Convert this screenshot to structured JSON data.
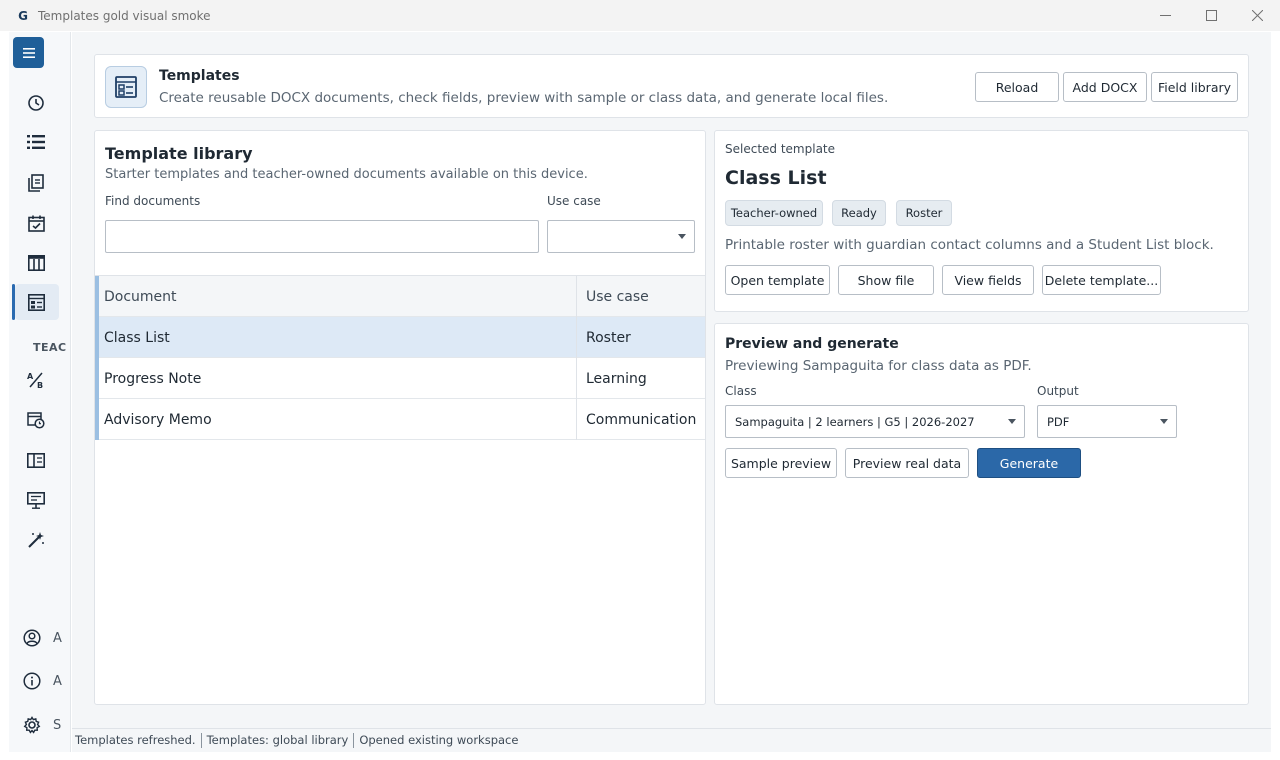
{
  "window": {
    "logo_glyph": "G",
    "title": "Templates gold visual smoke"
  },
  "sidebar": {
    "section_label": "TEAC",
    "nav_icons": [
      "history-icon",
      "list-icon",
      "documents-icon",
      "calendar-check-icon",
      "table-columns-icon",
      "templates-icon",
      "grading-icon",
      "schedule-icon",
      "book-icon",
      "presentation-icon",
      "magic-wand-icon"
    ],
    "active_item": "templates-icon",
    "bottom_items": [
      {
        "icon": "account-icon",
        "label": "A"
      },
      {
        "icon": "info-icon",
        "label": "A"
      },
      {
        "icon": "settings-icon",
        "label": "S"
      }
    ]
  },
  "header": {
    "title": "Templates",
    "subtitle": "Create reusable DOCX documents, check fields, preview with sample or class data, and generate local files.",
    "buttons": {
      "reload": "Reload",
      "add_docx": "Add DOCX",
      "field_library": "Field library"
    }
  },
  "library": {
    "title": "Template library",
    "subtitle": "Starter templates and teacher-owned documents available on this device.",
    "search_label": "Find documents",
    "search_value": "",
    "use_case_label": "Use case",
    "use_case_value": "",
    "columns": [
      "Document",
      "Use case"
    ],
    "rows": [
      {
        "document": "Class List",
        "use_case": "Roster",
        "selected": true
      },
      {
        "document": "Progress Note",
        "use_case": "Learning",
        "selected": false
      },
      {
        "document": "Advisory Memo",
        "use_case": "Communication",
        "selected": false
      }
    ]
  },
  "selected": {
    "label": "Selected template",
    "title": "Class List",
    "chips": [
      "Teacher-owned",
      "Ready",
      "Roster"
    ],
    "description": "Printable roster with guardian contact columns and a Student List block.",
    "buttons": {
      "open": "Open template",
      "show_file": "Show file",
      "view_fields": "View fields",
      "delete": "Delete template..."
    }
  },
  "generate": {
    "title": "Preview and generate",
    "subtitle": "Previewing Sampaguita for class data as PDF.",
    "class_label": "Class",
    "class_value": "Sampaguita | 2 learners | G5 | 2026-2027",
    "output_label": "Output",
    "output_value": "PDF",
    "buttons": {
      "sample": "Sample preview",
      "real": "Preview real data",
      "generate": "Generate"
    }
  },
  "status": [
    "Templates refreshed.",
    "Templates: global library",
    "Opened existing workspace"
  ],
  "colors": {
    "accent": "#2b68a8",
    "menu": "#1f5f99",
    "selected_row": "#dde9f6",
    "row_accent": "#9bbfe2"
  }
}
